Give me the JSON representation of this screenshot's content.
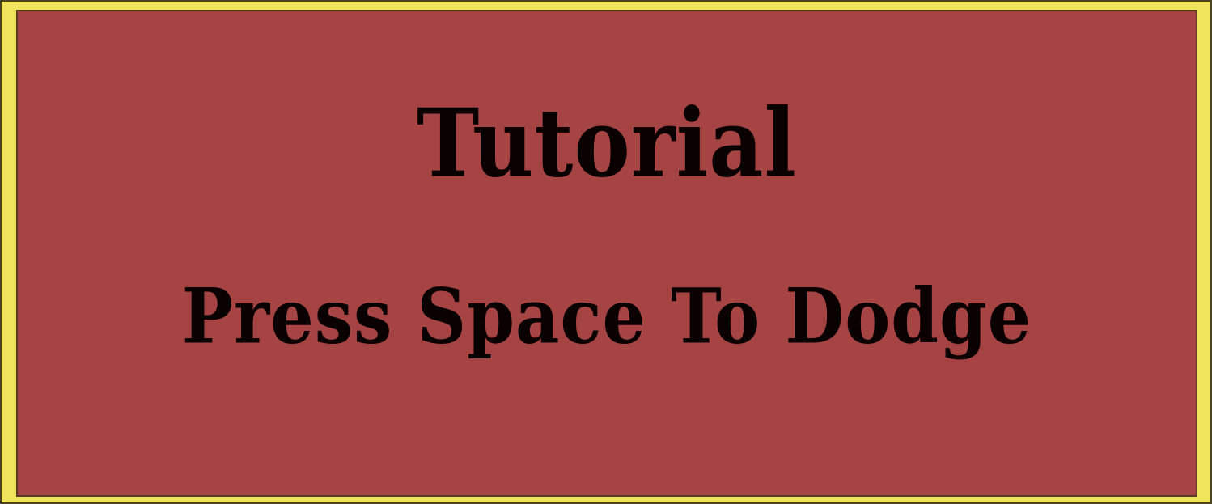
{
  "dialog": {
    "title": "Tutorial",
    "instruction": "Press Space To Dodge"
  },
  "colors": {
    "frame": "#f0e45b",
    "panel": "#a64444",
    "text": "#0a0000"
  }
}
